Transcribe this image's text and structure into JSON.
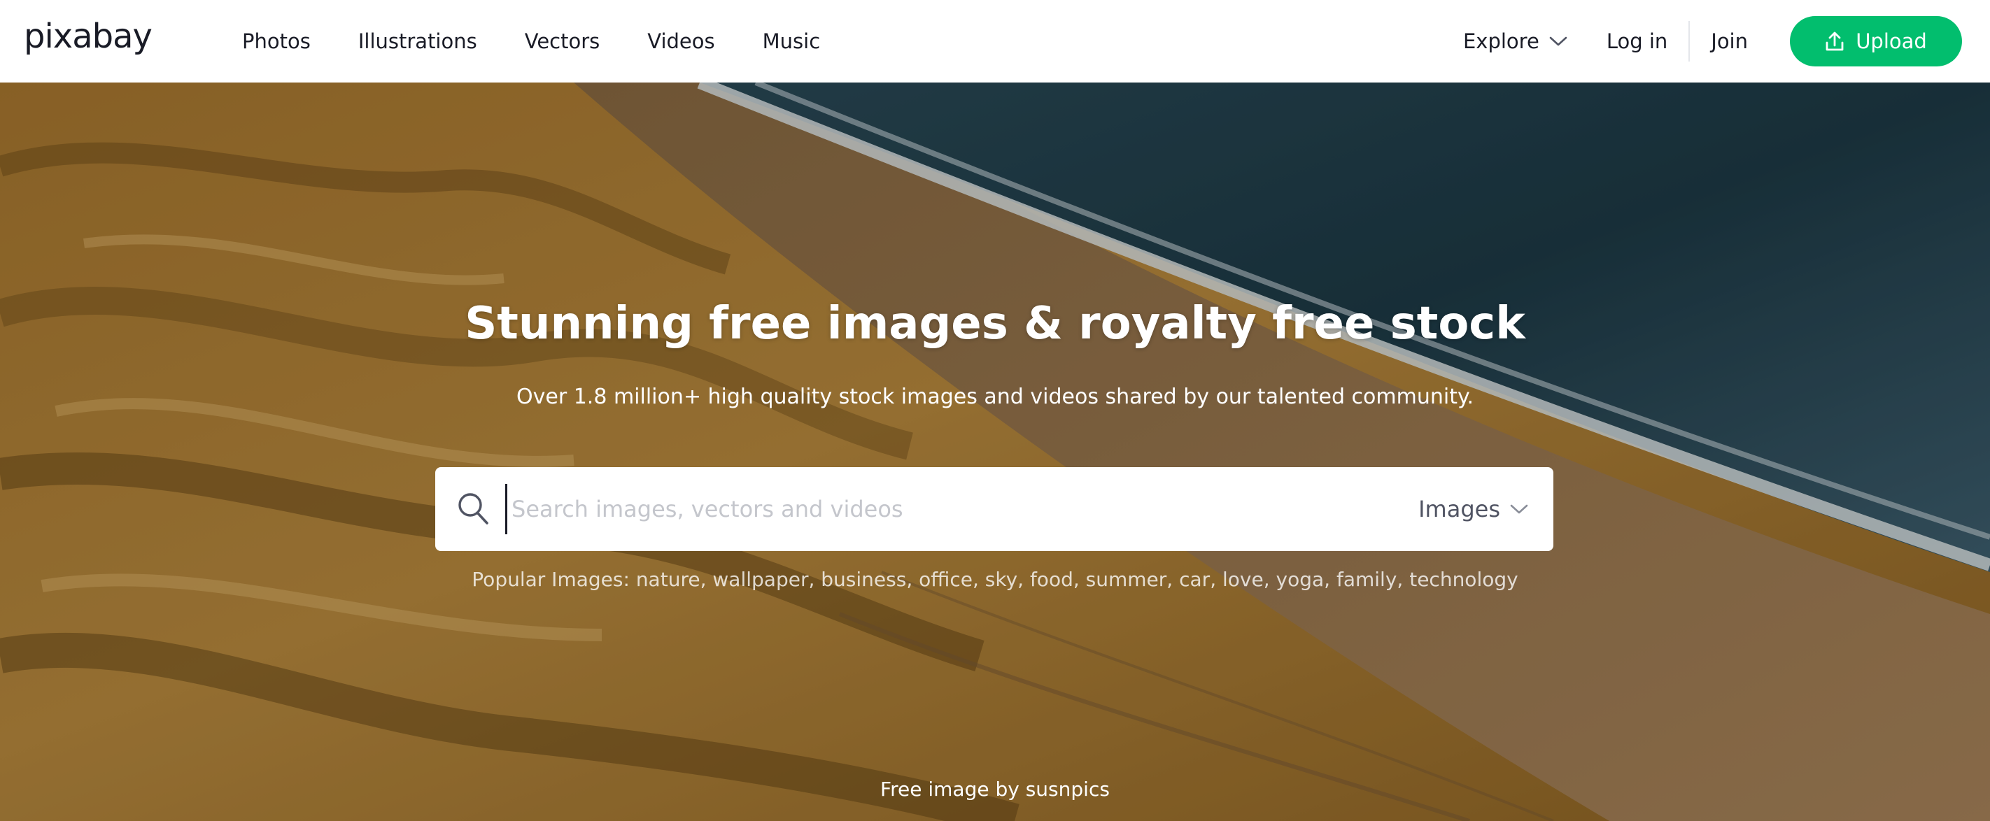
{
  "header": {
    "logo": "pixabay",
    "nav": [
      "Photos",
      "Illustrations",
      "Vectors",
      "Videos",
      "Music"
    ],
    "explore_label": "Explore",
    "login_label": "Log in",
    "join_label": "Join",
    "upload_label": "Upload",
    "accent_color": "#02be6e"
  },
  "hero": {
    "title": "Stunning free images & royalty free stock",
    "subtitle": "Over 1.8 million+ high quality stock images and videos shared by our talented community.",
    "search": {
      "placeholder": "Search images, vectors and videos",
      "type_selected": "Images"
    },
    "popular_prefix": "Popular Images:",
    "popular_tags": [
      "nature",
      "wallpaper",
      "business",
      "office",
      "sky",
      "food",
      "summer",
      "car",
      "love",
      "yoga",
      "family",
      "technology"
    ],
    "credit": "Free image by susnpics"
  }
}
